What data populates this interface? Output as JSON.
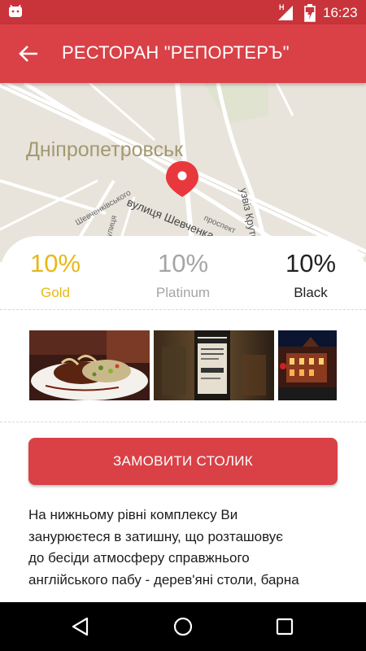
{
  "status_bar": {
    "time": "16:23",
    "network_label": "H",
    "icons": [
      "android-icon",
      "signal-icon",
      "battery-icon"
    ]
  },
  "app_bar": {
    "title": "РЕСТОРАН \"РЕПОРТЕРЪ\"",
    "back_icon": "arrow-back-icon"
  },
  "map": {
    "city_label": "Дніпропетровськ",
    "street_labels": [
      "узвіз Крутогірний",
      "вулиця Шевченка",
      "проспект",
      "Шевченківського",
      "вулиця"
    ],
    "marker_icon": "map-pin-icon",
    "marker_color": "#e8383d"
  },
  "tiers": [
    {
      "percent": "10%",
      "label": "Gold",
      "color": "#e6b918"
    },
    {
      "percent": "10%",
      "label": "Platinum",
      "color": "#a5a5a5"
    },
    {
      "percent": "10%",
      "label": "Black",
      "color": "#222222"
    }
  ],
  "gallery": {
    "photos": [
      "dish-photo",
      "bottle-photo",
      "building-photo"
    ]
  },
  "booking": {
    "button_label": "ЗАМОВИТИ СТОЛИК"
  },
  "description": {
    "lines": [
      "На нижньому рівні комплексу Ви",
      "занурюєтеся в затишну, що розташовує",
      "до бесіди атмосферу справжнього",
      "англійського пабу - дерев'яні столи, барна"
    ]
  },
  "colors": {
    "primary": "#d94147",
    "status_bar": "#c9343b",
    "gold": "#e6b918",
    "platinum": "#a5a5a5"
  },
  "nav_bar": {
    "icons": [
      "nav-back-icon",
      "nav-home-icon",
      "nav-recents-icon"
    ]
  }
}
